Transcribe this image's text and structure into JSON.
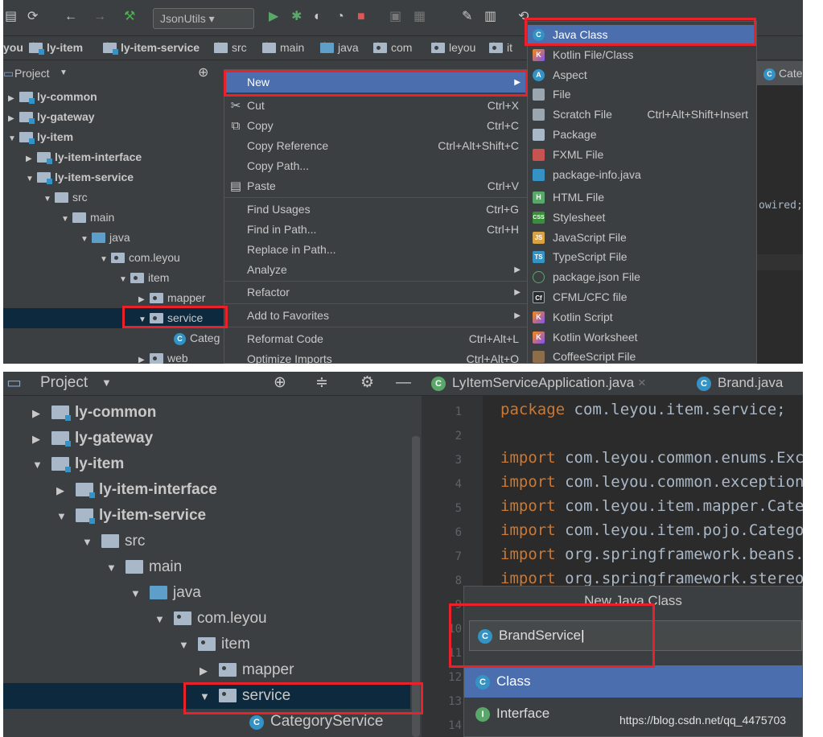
{
  "toolbar": {
    "config_combo": "JsonUtils"
  },
  "breadcrumb": [
    "you",
    "ly-item",
    "ly-item-service",
    "src",
    "main",
    "java",
    "com",
    "leyou",
    "it"
  ],
  "panel1": {
    "project_header": "Project",
    "tree": [
      {
        "label": "ly-common",
        "bold": true
      },
      {
        "label": "ly-gateway",
        "bold": true
      },
      {
        "label": "ly-item",
        "bold": true
      },
      {
        "label": "ly-item-interface",
        "bold": true
      },
      {
        "label": "ly-item-service",
        "bold": true
      },
      {
        "label": "src"
      },
      {
        "label": "main"
      },
      {
        "label": "java"
      },
      {
        "label": "com.leyou"
      },
      {
        "label": "item"
      },
      {
        "label": "mapper"
      },
      {
        "label": "service"
      },
      {
        "label": "Categ"
      },
      {
        "label": "web"
      }
    ],
    "context_menu": [
      {
        "label": "New",
        "submenu": true
      },
      {
        "label": "Cut",
        "shortcut": "Ctrl+X"
      },
      {
        "label": "Copy",
        "shortcut": "Ctrl+C"
      },
      {
        "label": "Copy Reference",
        "shortcut": "Ctrl+Alt+Shift+C"
      },
      {
        "label": "Copy Path..."
      },
      {
        "label": "Paste",
        "shortcut": "Ctrl+V"
      },
      {
        "label": "Find Usages",
        "shortcut": "Ctrl+G"
      },
      {
        "label": "Find in Path...",
        "shortcut": "Ctrl+H"
      },
      {
        "label": "Replace in Path..."
      },
      {
        "label": "Analyze",
        "submenu": true
      },
      {
        "label": "Refactor",
        "submenu": true
      },
      {
        "label": "Add to Favorites",
        "submenu": true
      },
      {
        "label": "Reformat Code",
        "shortcut": "Ctrl+Alt+L"
      },
      {
        "label": "Optimize Imports",
        "shortcut": "Ctrl+Alt+O"
      }
    ],
    "new_submenu": [
      {
        "label": "Java Class",
        "icon": "C"
      },
      {
        "label": "Kotlin File/Class",
        "icon": "K"
      },
      {
        "label": "Aspect",
        "icon": "A"
      },
      {
        "label": "File",
        "icon": ""
      },
      {
        "label": "Scratch File",
        "icon": "",
        "shortcut": "Ctrl+Alt+Shift+Insert"
      },
      {
        "label": "Package",
        "icon": ""
      },
      {
        "label": "FXML File",
        "icon": ""
      },
      {
        "label": "package-info.java",
        "icon": ""
      },
      {
        "label": "HTML File",
        "icon": "H"
      },
      {
        "label": "Stylesheet",
        "icon": "CSS"
      },
      {
        "label": "JavaScript File",
        "icon": "JS"
      },
      {
        "label": "TypeScript File",
        "icon": "TS"
      },
      {
        "label": "package.json File",
        "icon": ""
      },
      {
        "label": "CFML/CFC file",
        "icon": "Cf"
      },
      {
        "label": "Kotlin Script",
        "icon": "K"
      },
      {
        "label": "Kotlin Worksheet",
        "icon": "K"
      },
      {
        "label": "CoffeeScript File",
        "icon": ""
      }
    ],
    "editor_tab_partial": "Cate",
    "editor_code_partial": "owired;"
  },
  "panel2": {
    "project_header": "Project",
    "tree": [
      {
        "label": "ly-common"
      },
      {
        "label": "ly-gateway"
      },
      {
        "label": "ly-item"
      },
      {
        "label": "ly-item-interface"
      },
      {
        "label": "ly-item-service"
      },
      {
        "label": "src"
      },
      {
        "label": "main"
      },
      {
        "label": "java"
      },
      {
        "label": "com.leyou"
      },
      {
        "label": "item"
      },
      {
        "label": "mapper"
      },
      {
        "label": "service"
      },
      {
        "label": "CategoryService"
      }
    ],
    "tabs": [
      "LyItemServiceApplication.java",
      "Brand.java"
    ],
    "line_numbers": [
      "1",
      "2",
      "3",
      "4",
      "5",
      "6",
      "7",
      "8",
      "9",
      "10",
      "11",
      "12",
      "13",
      "14"
    ],
    "code": [
      {
        "kw": "package",
        "rest": " com.leyou.item.service;"
      },
      {
        "kw": "",
        "rest": ""
      },
      {
        "kw": "import",
        "rest": " com.leyou.common.enums.Exc"
      },
      {
        "kw": "import",
        "rest": " com.leyou.common.exception"
      },
      {
        "kw": "import",
        "rest": " com.leyou.item.mapper.Categ"
      },
      {
        "kw": "import",
        "rest": " com.leyou.item.pojo.Catego"
      },
      {
        "kw": "import",
        "rest": " org.springframework.beans."
      },
      {
        "kw": "import",
        "rest": " org.springframework.stereot"
      }
    ],
    "dialog": {
      "title": "New Java Class",
      "input_value": "BrandService",
      "options": [
        "Class",
        "Interface"
      ]
    }
  },
  "watermark": "https://blog.csdn.net/qq_4475703",
  "colors": {
    "accent": "#4b6eaf",
    "highlight_box": "#e8212b",
    "background": "#3c3f41"
  }
}
